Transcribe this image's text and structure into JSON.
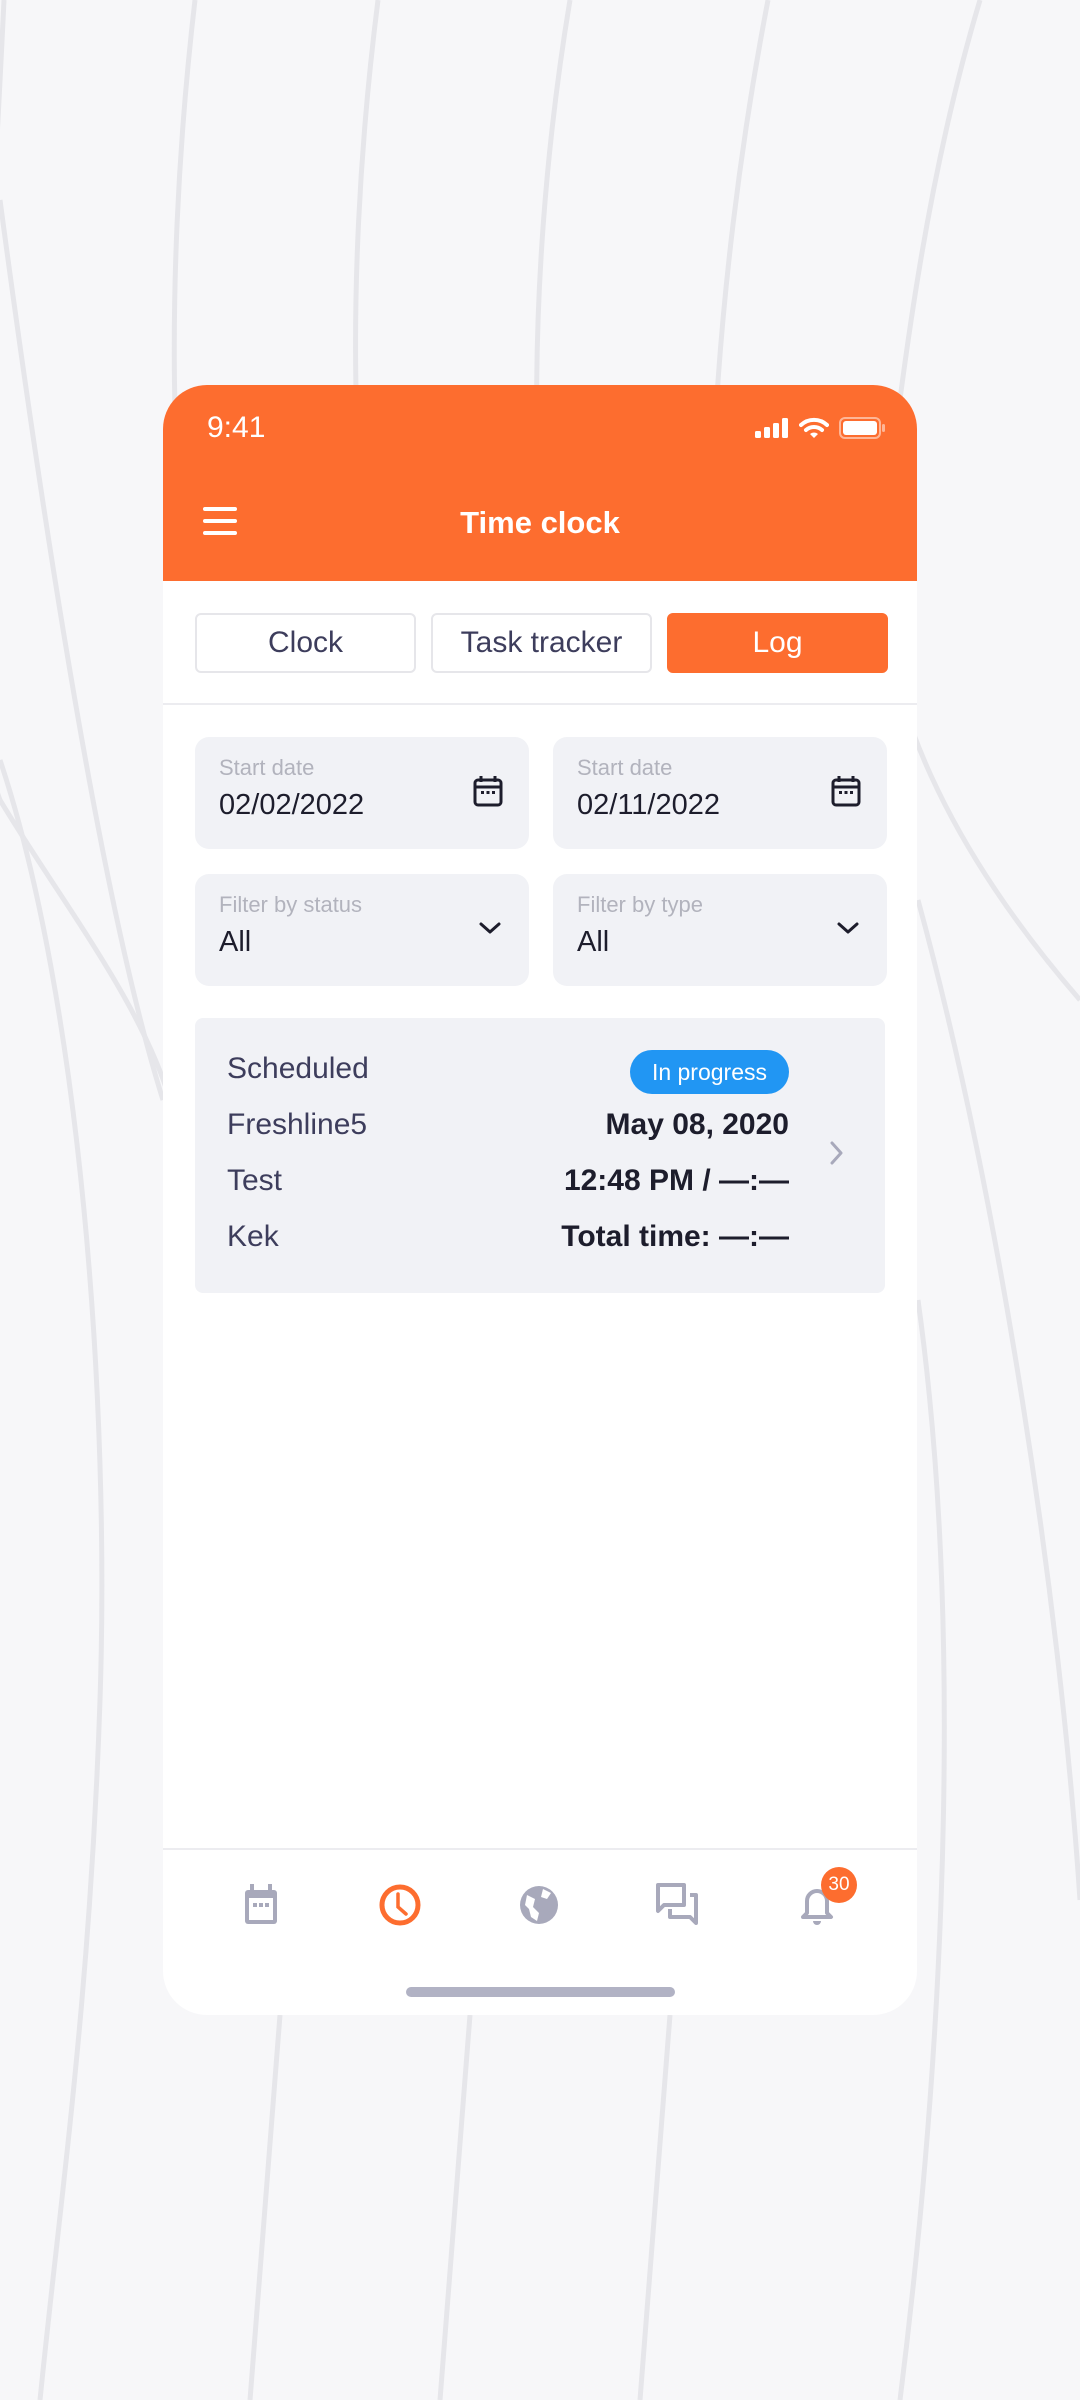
{
  "status_bar": {
    "time": "9:41",
    "icons": [
      "signal-icon",
      "wifi-icon",
      "battery-icon"
    ]
  },
  "header": {
    "title": "Time clock",
    "menu_icon": "hamburger-menu-icon"
  },
  "tabs": [
    {
      "label": "Clock",
      "active": false
    },
    {
      "label": "Task tracker",
      "active": false
    },
    {
      "label": "Log",
      "active": true
    }
  ],
  "filters": {
    "start_date": {
      "label": "Start date",
      "value": "02/02/2022",
      "icon": "calendar-icon"
    },
    "end_date": {
      "label": "Start date",
      "value": "02/11/2022",
      "icon": "calendar-icon"
    },
    "status": {
      "label": "Filter by status",
      "value": "All",
      "icon": "chevron-down-icon"
    },
    "type": {
      "label": "Filter by type",
      "value": "All",
      "icon": "chevron-down-icon"
    }
  },
  "log_entries": [
    {
      "left": [
        "Scheduled",
        "Freshline5",
        "Test",
        "Kek"
      ],
      "status_badge": "In progress",
      "date": "May 08, 2020",
      "time_range": "12:48 PM / —:—",
      "total_time": "Total time: —:—"
    }
  ],
  "bottom_nav": [
    {
      "name": "calendar",
      "icon": "calendar-icon",
      "active": false
    },
    {
      "name": "time-clock",
      "icon": "clock-icon",
      "active": true
    },
    {
      "name": "globe",
      "icon": "globe-icon",
      "active": false
    },
    {
      "name": "chat",
      "icon": "chat-icon",
      "active": false
    },
    {
      "name": "notifications",
      "icon": "bell-icon",
      "active": false,
      "badge": "30"
    }
  ],
  "colors": {
    "accent": "#fd6d2f",
    "badge_blue": "#2196f3",
    "icon_inactive": "#a8a9bb",
    "field_bg": "#f1f2f6"
  }
}
